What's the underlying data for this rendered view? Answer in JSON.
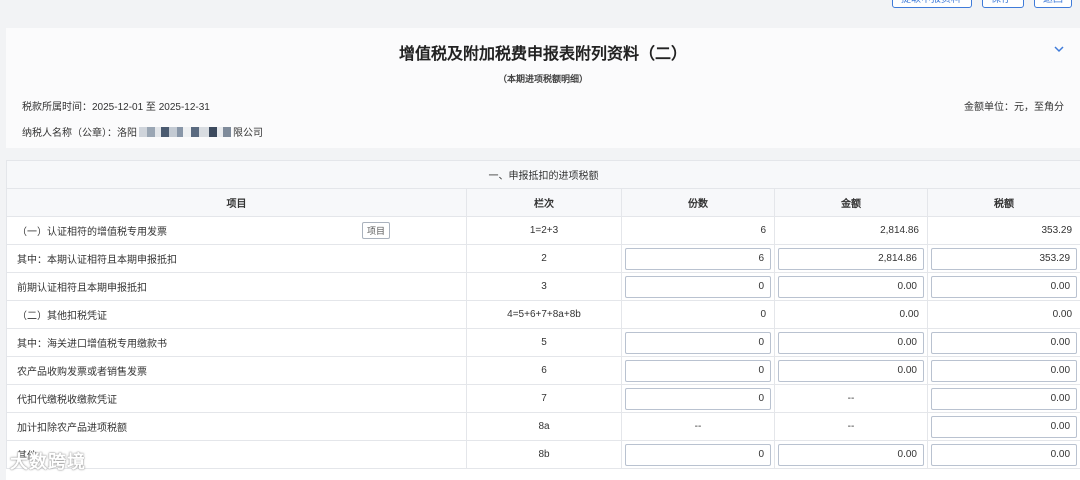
{
  "top_actions": [
    {
      "label": "提取申报资料"
    },
    {
      "label": "保存"
    },
    {
      "label": "返回"
    }
  ],
  "header": {
    "title": "增值税及附加税费申报表附列资料（二）",
    "subtitle": "（本期进项税额明细）",
    "period": "税款所属时间：2025-12-01 至 2025-12-31",
    "unit": "金额单位：元，至角分",
    "taxpayer_prefix": "纳税人名称（公章）：洛阳",
    "taxpayer_suffix": "限公司"
  },
  "table": {
    "section_title": "一、申报抵扣的进项税额",
    "columns": [
      "项目",
      "栏次",
      "份数",
      "金额",
      "税额"
    ],
    "tooltip": "项目",
    "rows": [
      {
        "item": "（一）认证相符的增值税专用发票",
        "col": "1=2+3",
        "count": "6",
        "amount": "2,814.86",
        "tax": "353.29",
        "editable": [
          false,
          false,
          false
        ]
      },
      {
        "item": "其中：本期认证相符且本期申报抵扣",
        "col": "2",
        "count": "6",
        "amount": "2,814.86",
        "tax": "353.29",
        "editable": [
          true,
          true,
          true
        ]
      },
      {
        "item": "前期认证相符且本期申报抵扣",
        "col": "3",
        "count": "0",
        "amount": "0.00",
        "tax": "0.00",
        "editable": [
          true,
          true,
          true
        ]
      },
      {
        "item": "（二）其他扣税凭证",
        "col": "4=5+6+7+8a+8b",
        "count": "0",
        "amount": "0.00",
        "tax": "0.00",
        "editable": [
          false,
          false,
          false
        ]
      },
      {
        "item": "其中：海关进口增值税专用缴款书",
        "col": "5",
        "count": "0",
        "amount": "0.00",
        "tax": "0.00",
        "editable": [
          true,
          true,
          true
        ]
      },
      {
        "item": "农产品收购发票或者销售发票",
        "col": "6",
        "count": "0",
        "amount": "0.00",
        "tax": "0.00",
        "editable": [
          true,
          true,
          true
        ]
      },
      {
        "item": "代扣代缴税收缴款凭证",
        "col": "7",
        "count": "0",
        "amount": "--",
        "tax": "0.00",
        "editable": [
          true,
          false,
          true
        ]
      },
      {
        "item": "加计扣除农产品进项税额",
        "col": "8a",
        "count": "--",
        "amount": "--",
        "tax": "0.00",
        "editable": [
          false,
          false,
          true
        ]
      },
      {
        "item": "其他",
        "col": "8b",
        "count": "0",
        "amount": "0.00",
        "tax": "0.00",
        "editable": [
          true,
          true,
          true
        ]
      }
    ]
  },
  "watermark": "大数跨境"
}
